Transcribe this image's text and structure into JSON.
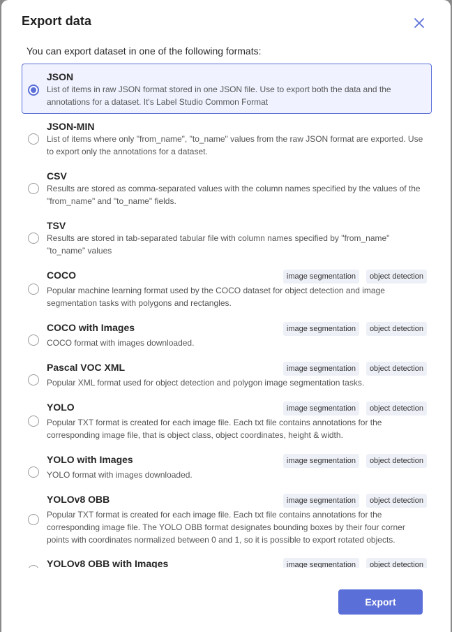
{
  "dialog": {
    "title": "Export data",
    "intro": "You can export dataset in one of the following formats:",
    "export_label": "Export",
    "accent_color": "#5b6fd8",
    "close_icon": "close-icon"
  },
  "formats": [
    {
      "name": "JSON",
      "description": "List of items in raw JSON format stored in one JSON file. Use to export both the data and the annotations for a dataset. It's Label Studio Common Format",
      "selected": true,
      "tags": []
    },
    {
      "name": "JSON-MIN",
      "description": "List of items where only \"from_name\", \"to_name\" values from the raw JSON format are exported. Use to export only the annotations for a dataset.",
      "selected": false,
      "tags": []
    },
    {
      "name": "CSV",
      "description": "Results are stored as comma-separated values with the column names specified by the values of the \"from_name\" and \"to_name\" fields.",
      "selected": false,
      "tags": []
    },
    {
      "name": "TSV",
      "description": "Results are stored in tab-separated tabular file with column names specified by \"from_name\" \"to_name\" values",
      "selected": false,
      "tags": []
    },
    {
      "name": "COCO",
      "description": "Popular machine learning format used by the COCO dataset for object detection and image segmentation tasks with polygons and rectangles.",
      "selected": false,
      "tags": [
        "image segmentation",
        "object detection"
      ]
    },
    {
      "name": "COCO with Images",
      "description": "COCO format with images downloaded.",
      "selected": false,
      "tags": [
        "image segmentation",
        "object detection"
      ]
    },
    {
      "name": "Pascal VOC XML",
      "description": "Popular XML format used for object detection and polygon image segmentation tasks.",
      "selected": false,
      "tags": [
        "image segmentation",
        "object detection"
      ]
    },
    {
      "name": "YOLO",
      "description": "Popular TXT format is created for each image file. Each txt file contains annotations for the corresponding image file, that is object class, object coordinates, height & width.",
      "selected": false,
      "tags": [
        "image segmentation",
        "object detection"
      ]
    },
    {
      "name": "YOLO with Images",
      "description": "YOLO format with images downloaded.",
      "selected": false,
      "tags": [
        "image segmentation",
        "object detection"
      ]
    },
    {
      "name": "YOLOv8 OBB",
      "description": "Popular TXT format is created for each image file. Each txt file contains annotations for the corresponding image file. The YOLO OBB format designates bounding boxes by their four corner points with coordinates normalized between 0 and 1, so it is possible to export rotated objects.",
      "selected": false,
      "tags": [
        "image segmentation",
        "object detection"
      ]
    },
    {
      "name": "YOLOv8 OBB with Images",
      "description": "",
      "selected": false,
      "tags": [
        "image segmentation",
        "object detection"
      ]
    }
  ]
}
